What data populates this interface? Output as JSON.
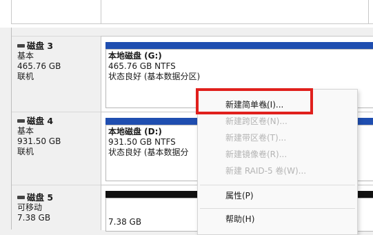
{
  "disks": [
    {
      "name": "磁盘 3",
      "type": "基本",
      "size": "465.76 GB",
      "status": "联机",
      "volume": {
        "title": "本地磁盘  (G:)",
        "fs": "465.76 GB NTFS",
        "state": "状态良好 (基本数据分区)"
      }
    },
    {
      "name": "磁盘 4",
      "type": "基本",
      "size": "931.50 GB",
      "status": "联机",
      "volume": {
        "title": "本地磁盘  (D:)",
        "fs": "931.50 GB NTFS",
        "state": "状态良好 (基本数据分"
      }
    },
    {
      "name": "磁盘 5",
      "type": "可移动",
      "size": "7.38 GB",
      "volume": {
        "size": "7.38 GB"
      }
    }
  ],
  "context_menu": {
    "items": [
      {
        "label": "新建简单卷(I)...",
        "enabled": true
      },
      {
        "label": "新建跨区卷(N)...",
        "enabled": false
      },
      {
        "label": "新建带区卷(T)...",
        "enabled": false
      },
      {
        "label": "新建镜像卷(R)...",
        "enabled": false
      },
      {
        "label": "新建 RAID-5 卷(W)...",
        "enabled": false
      },
      {
        "label": "属性(P)",
        "enabled": true
      },
      {
        "label": "帮助(H)",
        "enabled": true
      }
    ]
  },
  "colors": {
    "primary_partition": "#1f4eb0",
    "unallocated": "#111111",
    "highlight": "#e0201d"
  }
}
